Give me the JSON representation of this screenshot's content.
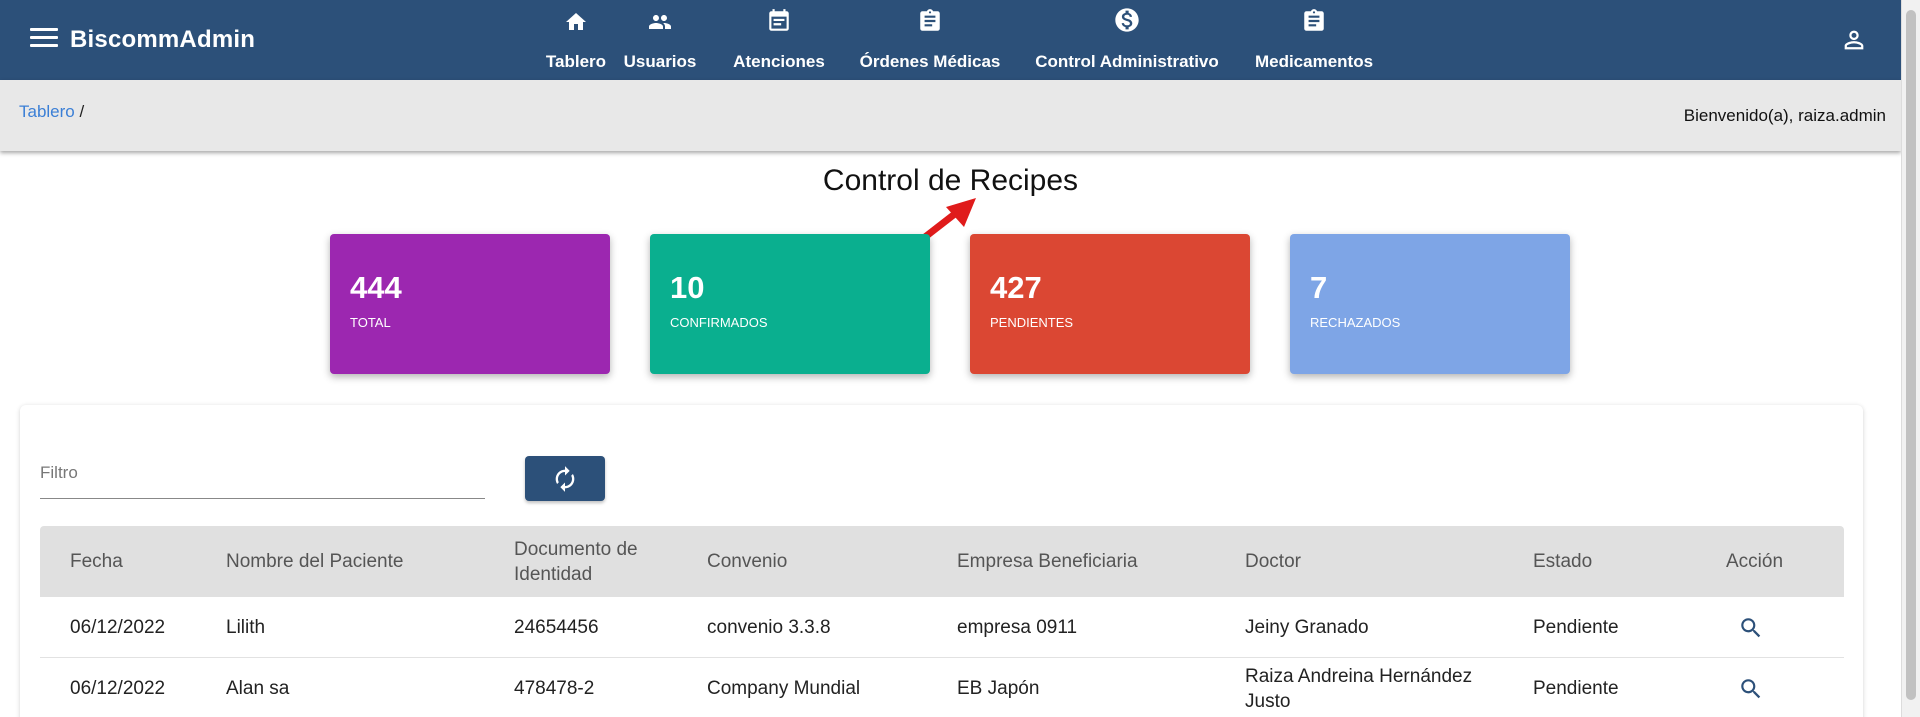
{
  "app": {
    "brand": "BiscommAdmin"
  },
  "nav": [
    {
      "label": "Tablero",
      "icon": "home-icon"
    },
    {
      "label": "Usuarios",
      "icon": "users-icon"
    },
    {
      "label": "Atenciones",
      "icon": "calendar-icon"
    },
    {
      "label": "Órdenes Médicas",
      "icon": "clipboard-icon"
    },
    {
      "label": "Control Administrativo",
      "icon": "dollar-circle-icon"
    },
    {
      "label": "Medicamentos",
      "icon": "clipboard-icon"
    }
  ],
  "breadcrumb": {
    "root": "Tablero",
    "separator": "/"
  },
  "welcome": "Bienvenido(a), raiza.admin",
  "page": {
    "title": "Control de Recipes"
  },
  "stats": [
    {
      "value": "444",
      "label": "TOTAL",
      "color": "#9c27b0"
    },
    {
      "value": "10",
      "label": "CONFIRMADOS",
      "color": "#0aaf8f"
    },
    {
      "value": "427",
      "label": "PENDIENTES",
      "color": "#db4733"
    },
    {
      "value": "7",
      "label": "RECHAZADOS",
      "color": "#7ea5e6"
    }
  ],
  "filter": {
    "placeholder": "Filtro",
    "value": ""
  },
  "table": {
    "headers": [
      "Fecha",
      "Nombre del Paciente",
      "Documento de Identidad",
      "Convenio",
      "Empresa Beneficiaria",
      "Doctor",
      "Estado",
      "Acción"
    ],
    "rows": [
      [
        "06/12/2022",
        "Lilith",
        "24654456",
        "convenio 3.3.8",
        "empresa 0911",
        "Jeiny Granado",
        "Pendiente"
      ],
      [
        "06/12/2022",
        "Alan sa",
        "478478-2",
        "Company Mundial",
        "EB Japón",
        "Raiza Andreina Hernández Justo",
        "Pendiente"
      ]
    ]
  },
  "colors": {
    "primary": "#2c5079",
    "link": "#3b7fd6",
    "annotation_arrow": "#e01b1b"
  }
}
